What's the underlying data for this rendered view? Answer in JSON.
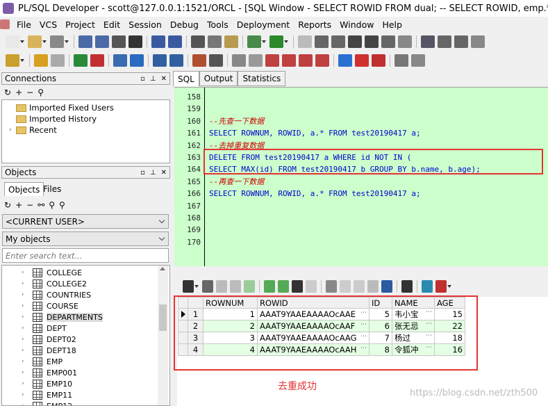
{
  "window": {
    "title": "PL/SQL Developer - scott@127.0.0.1:1521/ORCL - [SQL Window - SELECT ROWID FROM dual; -- SELECT ROWID, emp.* from employ"
  },
  "menu": [
    "File",
    "VCS",
    "Project",
    "Edit",
    "Session",
    "Debug",
    "Tools",
    "Deployment",
    "Reports",
    "Window",
    "Help"
  ],
  "connections": {
    "title": "Connections",
    "items": [
      "Imported Fixed Users",
      "Imported History",
      "Recent"
    ]
  },
  "objects": {
    "title": "Objects",
    "tabs": [
      "Objects",
      "Files"
    ],
    "user_combo": "<CURRENT USER>",
    "filter_combo": "My objects",
    "search_placeholder": "Enter search text...",
    "items": [
      "COLLEGE",
      "COLLEGE2",
      "COUNTRIES",
      "COURSE",
      "DEPARTMENTS",
      "DEPT",
      "DEPT02",
      "DEPT18",
      "EMP",
      "EMP001",
      "EMP10",
      "EMP11",
      "EMP12"
    ],
    "selected": "DEPARTMENTS"
  },
  "editor": {
    "tabs": [
      "SQL",
      "Output",
      "Statistics"
    ],
    "lines": [
      {
        "n": "158",
        "parts": []
      },
      {
        "n": "159",
        "parts": []
      },
      {
        "n": "160",
        "parts": [
          {
            "t": "--先查一下数据",
            "c": "cm"
          }
        ]
      },
      {
        "n": "161",
        "parts": [
          {
            "t": "SELECT ROWNUM, ROWID, a.* FROM test20190417 a;",
            "c": "kw"
          }
        ]
      },
      {
        "n": "162",
        "parts": [
          {
            "t": "--去掉重复数据",
            "c": "cm"
          }
        ]
      },
      {
        "n": "163",
        "parts": [
          {
            "t": "DELETE FROM test20190417 a WHERE id NOT IN (",
            "c": "kw"
          }
        ]
      },
      {
        "n": "164",
        "parts": [
          {
            "t": "SELECT MAX(id) FROM test20190417 b GROUP BY b.name, b.age);",
            "c": "kw"
          }
        ]
      },
      {
        "n": "165",
        "parts": [
          {
            "t": "--再查一下数据",
            "c": "cm"
          }
        ]
      },
      {
        "n": "166",
        "parts": [
          {
            "t": "SELECT ROWNUM, ROWID, a.* FROM test20190417 a;",
            "c": "kw"
          }
        ]
      },
      {
        "n": "167",
        "parts": []
      },
      {
        "n": "168",
        "parts": []
      },
      {
        "n": "169",
        "parts": []
      },
      {
        "n": "170",
        "parts": []
      }
    ]
  },
  "grid": {
    "columns": [
      "ROWNUM",
      "ROWID",
      "ID",
      "NAME",
      "AGE"
    ],
    "rows": [
      {
        "num": "1",
        "rownum": "1",
        "rowid": "AAAT9YAAEAAAAOcAAE",
        "id": "5",
        "name": "韦小宝",
        "age": "15"
      },
      {
        "num": "2",
        "rownum": "2",
        "rowid": "AAAT9YAAEAAAAOcAAF",
        "id": "6",
        "name": "张无忌",
        "age": "22"
      },
      {
        "num": "3",
        "rownum": "3",
        "rowid": "AAAT9YAAEAAAAOcAAG",
        "id": "7",
        "name": "杨过",
        "age": "18"
      },
      {
        "num": "4",
        "rownum": "4",
        "rowid": "AAAT9YAAEAAAAOcAAH",
        "id": "8",
        "name": "令狐冲",
        "age": "16"
      }
    ]
  },
  "caption": "去重成功",
  "watermark": "https://blog.csdn.net/zth500",
  "colors": {
    "editor_bg": "#ccffcc",
    "keyword": "#0000cc",
    "comment": "#cc0000",
    "highlight_box": "#e53333"
  }
}
